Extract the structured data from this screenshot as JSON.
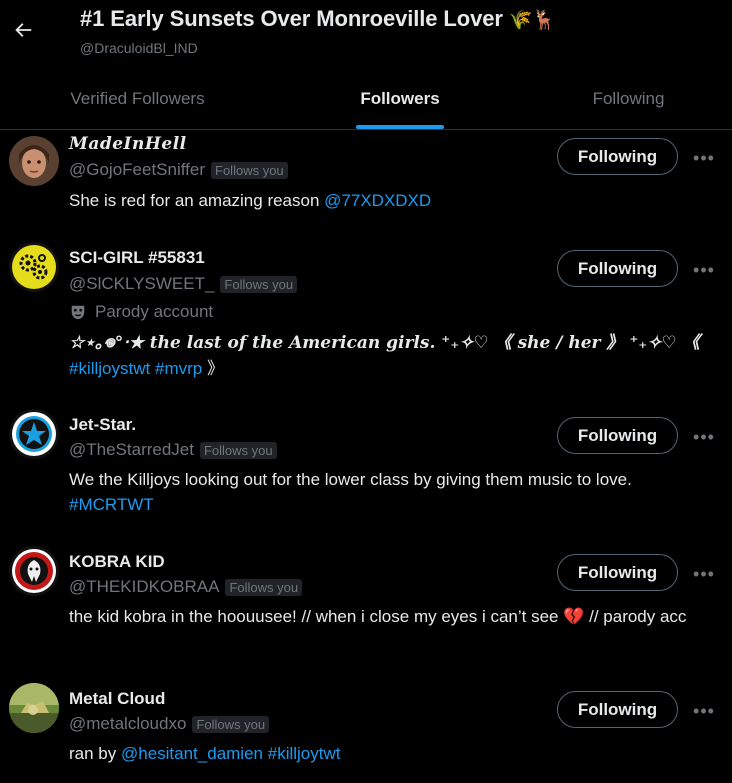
{
  "header": {
    "title": "#1 Early Sunsets Over Monroeville Lover",
    "title_emoji": "🌾🦌",
    "handle": "@DraculoidBl_IND"
  },
  "tabs": [
    {
      "label": "Verified Followers",
      "active": false
    },
    {
      "label": "Followers",
      "active": true
    },
    {
      "label": "Following",
      "active": false
    }
  ],
  "colors": {
    "accent": "#1d9bf0",
    "muted": "#71767b",
    "background": "#000000"
  },
  "users": [
    {
      "name": "𝑴𝒂𝒅𝒆𝑰𝒏𝑯𝒆𝒍𝒍",
      "handle": "@GojoFeetSniffer",
      "follows_you": "Follows you",
      "button": "Following",
      "bio_text": "She is red for an amazing reason ",
      "bio_link": "@77XDXDXD"
    },
    {
      "name": "SCI-GIRL #55831",
      "handle": "@SlCKLYSWEET_",
      "follows_you": "Follows you",
      "button": "Following",
      "parody": "Parody account",
      "bio_line1": "☆⋆｡𖦹°‧★ 𝒕𝒉𝒆 𝒍𝒂𝒔𝒕 𝒐𝒇 𝒕𝒉𝒆 𝑨𝒎𝒆𝒓𝒊𝒄𝒂𝒏 𝒈𝒊𝒓𝒍𝒔. ⁺₊✧♡ 《 𝒔𝒉𝒆 / 𝒉𝒆𝒓 》 ⁺₊✧♡ 《",
      "bio_link1": "#killjoystwt",
      "bio_link2": "#mvrp",
      "bio_end": " 》"
    },
    {
      "name": "Jet-Star.",
      "handle": "@TheStarredJet",
      "follows_you": "Follows you",
      "button": "Following",
      "bio_text": "We the Killjoys looking out for the lower class by giving them music to love.",
      "bio_link": "#MCRTWT"
    },
    {
      "name": "KOBRA KID",
      "handle": "@THEKIDKOBRAA",
      "follows_you": "Follows you",
      "button": "Following",
      "bio_text": "the kid kobra in the hoouusee! // when i close my eyes i can’t see 💔 // parody acc"
    },
    {
      "name": "Metal Cloud",
      "handle": "@metalcloudxo",
      "follows_you": "Follows you",
      "button": "Following",
      "bio_text": "ran by ",
      "bio_link1": "@hesitant_damien",
      "bio_link2": "#killjoytwt"
    }
  ],
  "icons": {
    "back": "arrow-left-icon",
    "more": "more-icon",
    "parody": "theater-mask-icon"
  }
}
